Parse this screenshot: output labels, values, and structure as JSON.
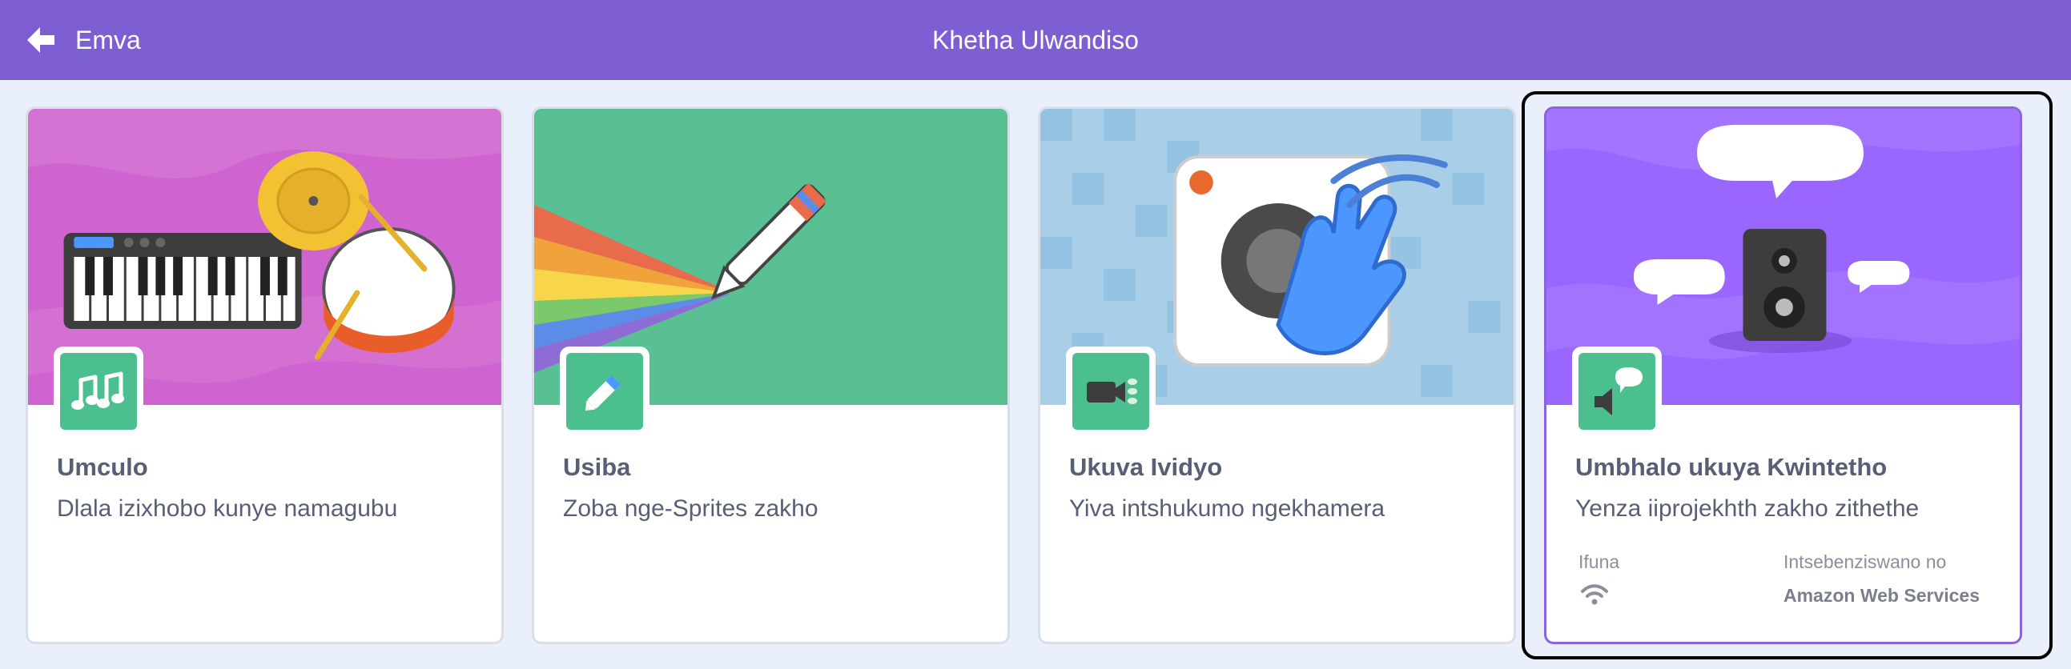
{
  "header": {
    "back_label": "Emva",
    "title": "Khetha Ulwandiso"
  },
  "colors": {
    "header_bg": "#7e5fd3",
    "page_bg": "#e9f0fb",
    "badge_green": "#4cbf8f",
    "selected_border": "#8a63dd"
  },
  "extensions": [
    {
      "name": "Umculo",
      "description": "Dlala izixhobo kunye namagubu",
      "icon": "music-notes-icon",
      "image": "keyboard-and-drums"
    },
    {
      "name": "Usiba",
      "description": "Zoba nge-Sprites zakho",
      "icon": "pen-icon",
      "image": "rainbow-pen"
    },
    {
      "name": "Ukuva Ividyo",
      "description": "Yiva intshukumo ngekhamera",
      "icon": "video-camera-icon",
      "image": "camera-and-hand"
    },
    {
      "name": "Umbhalo ukuya Kwintetho",
      "description": "Yenza iiprojekhth zakho zithethe",
      "icon": "speech-bubble-speaker-icon",
      "image": "speaker-with-speech-bubbles",
      "selected": true,
      "requires_label": "Ifuna",
      "requires_icon": "wifi-icon",
      "collaboration_label": "Intsebenziswano no",
      "collaboration_value": "Amazon Web Services"
    }
  ]
}
